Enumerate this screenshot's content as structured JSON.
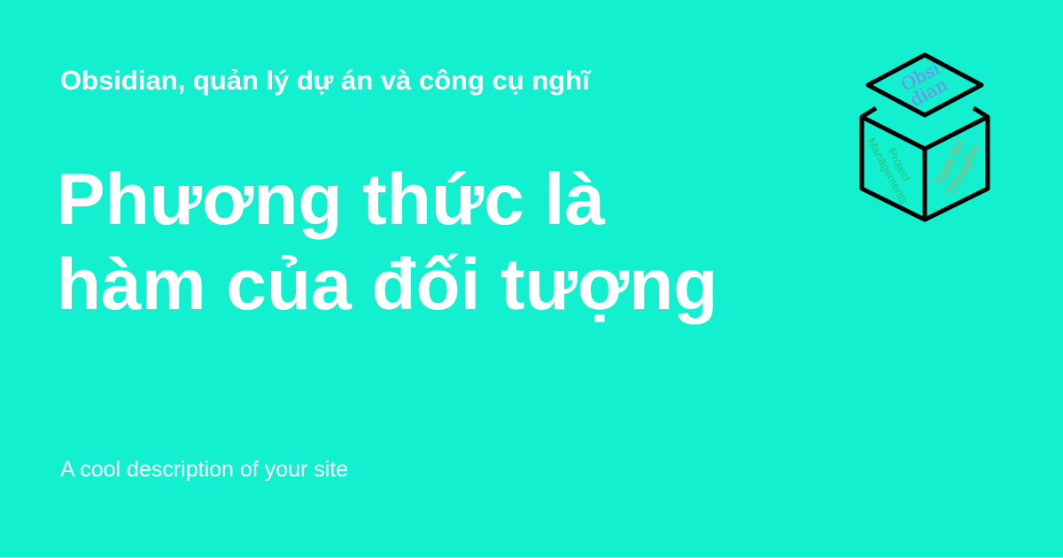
{
  "page": {
    "background": "#13f0d0",
    "text_color": "#ffffff"
  },
  "site": {
    "title": "Obsidian, quản lý dự án và công cụ nghĩ",
    "description": "A cool description of your site"
  },
  "post": {
    "title_lines": [
      "Phương thức là",
      "hàm của đối tượng"
    ]
  },
  "logo": {
    "icon": "cube-logo-icon",
    "top_face": [
      "Obsi",
      "dian"
    ],
    "left_face": [
      "Project",
      "Managements"
    ],
    "right_face": [
      "Tools for",
      "Thoughts"
    ],
    "colors": {
      "outline": "#000000",
      "top_text": "#8a7df0",
      "left_text": "#20c47a",
      "right_text": "#b5a96a"
    }
  }
}
